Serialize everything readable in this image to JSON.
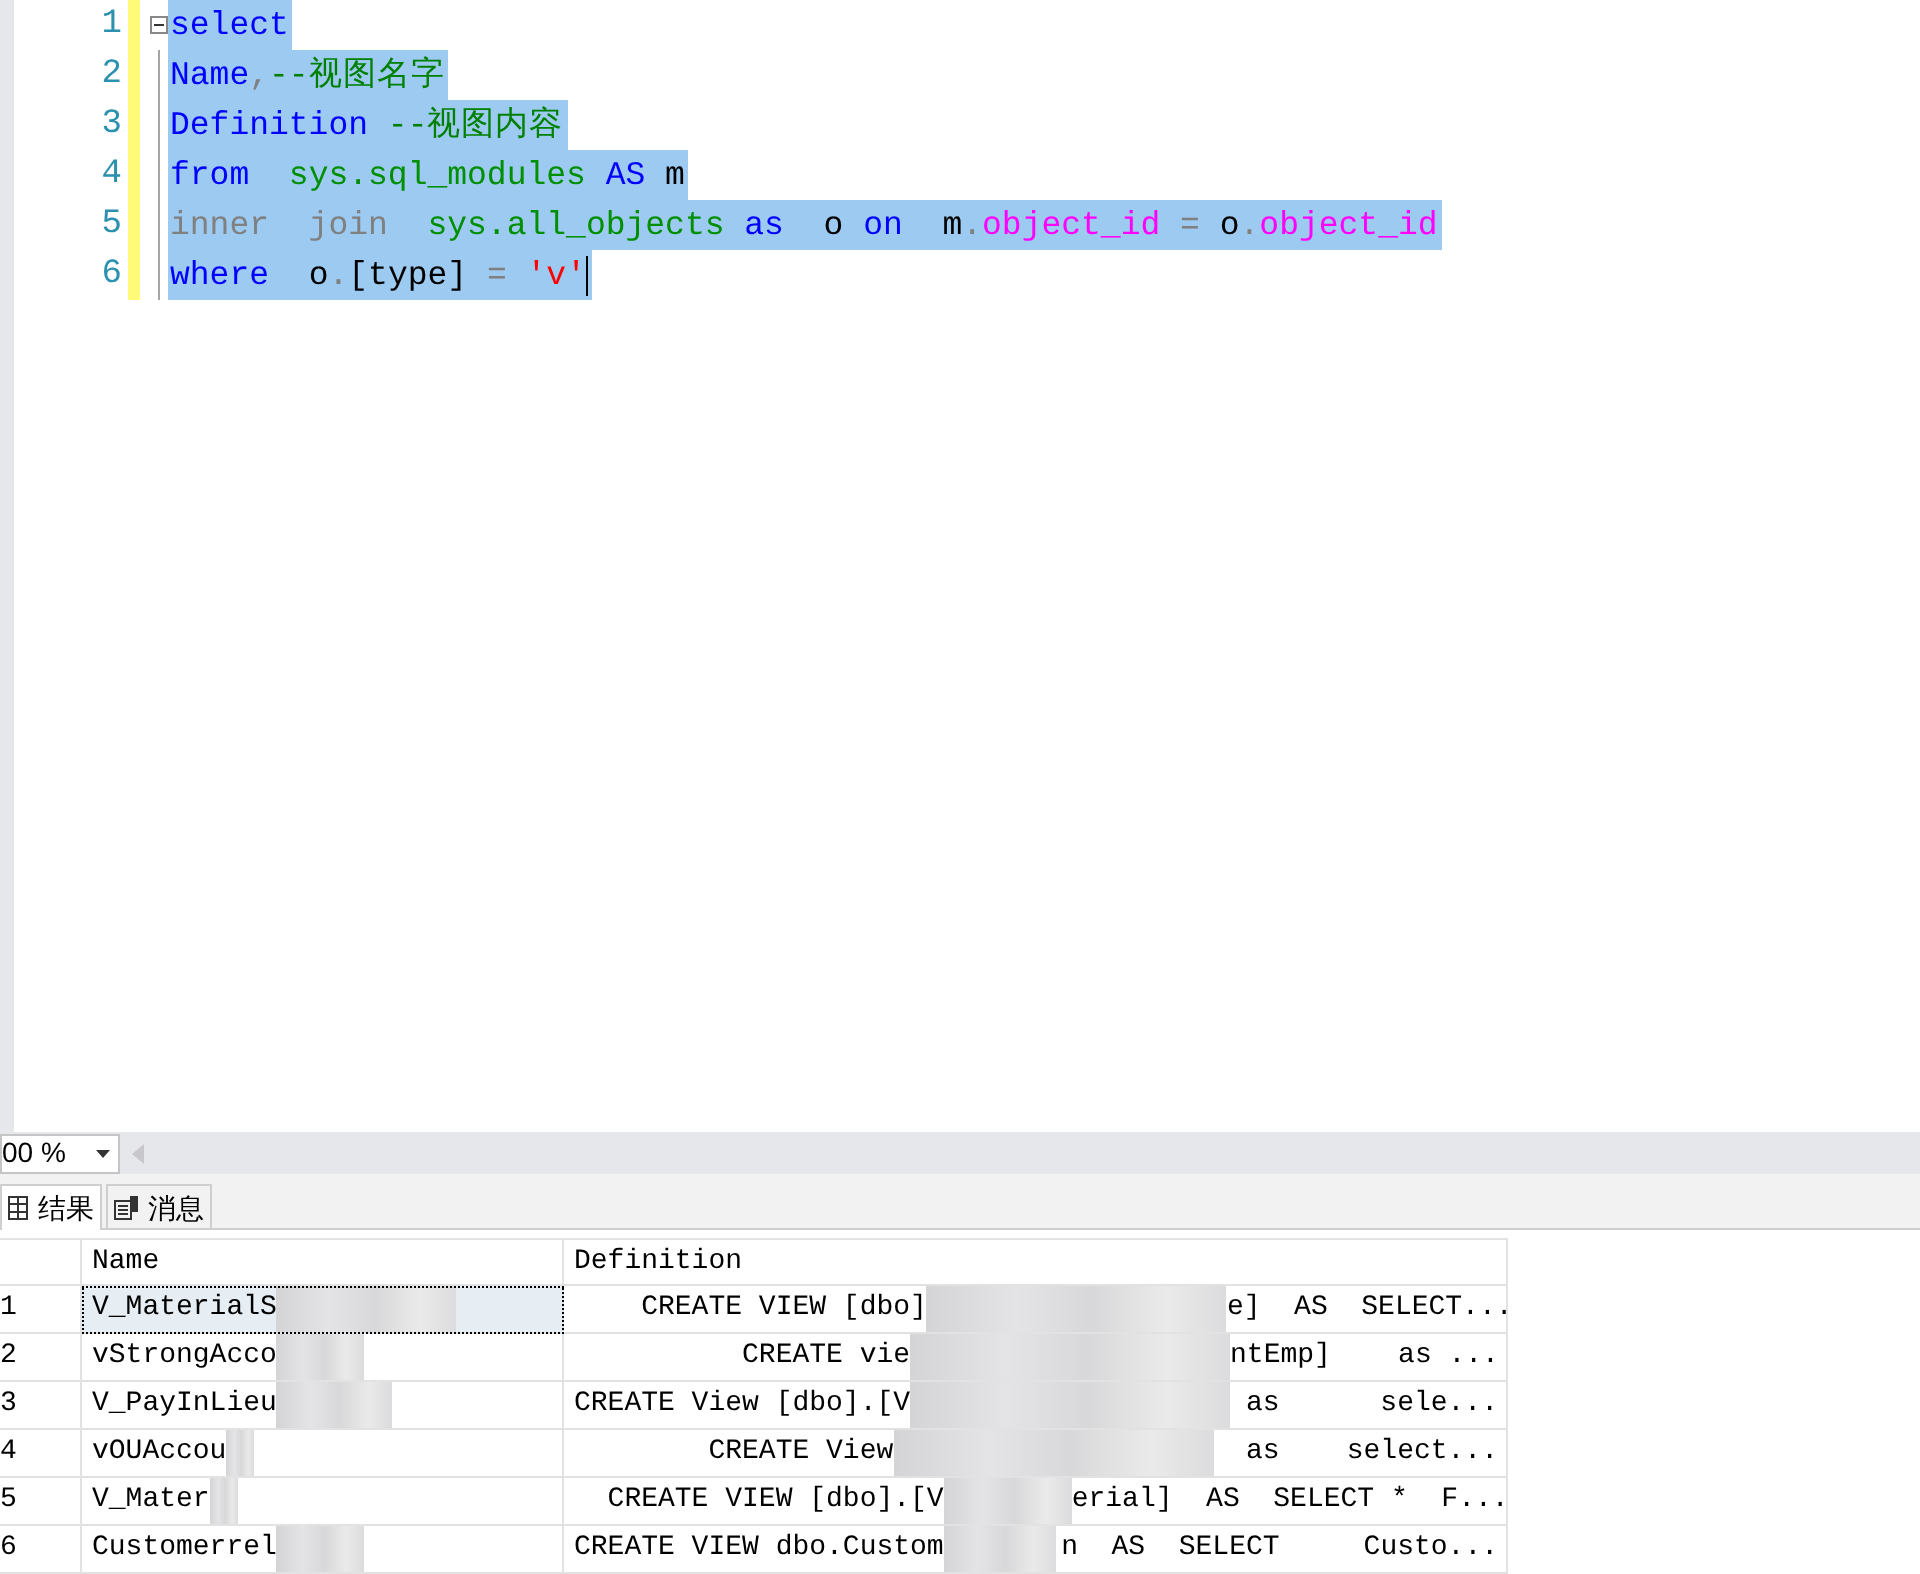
{
  "editor": {
    "lines": [
      {
        "number": "1",
        "selected": true,
        "fold": true,
        "tokens": [
          {
            "kind": "keyword",
            "text": "select"
          }
        ]
      },
      {
        "number": "2",
        "selected": true,
        "fold": false,
        "tokens": [
          {
            "kind": "keyword",
            "text": "Name"
          },
          {
            "kind": "operator",
            "text": ","
          },
          {
            "kind": "comment",
            "text": "--视图名字"
          }
        ]
      },
      {
        "number": "3",
        "selected": true,
        "fold": false,
        "tokens": [
          {
            "kind": "keyword",
            "text": "Definition"
          },
          {
            "kind": "comment",
            "text": " --视图内容"
          }
        ]
      },
      {
        "number": "4",
        "selected": true,
        "fold": false,
        "tokens": [
          {
            "kind": "keyword",
            "text": "from"
          },
          {
            "kind": "system",
            "text": "  sys.sql_modules"
          },
          {
            "kind": "keyword",
            "text": " AS"
          },
          {
            "kind": "plain",
            "text": " m"
          }
        ]
      },
      {
        "number": "5",
        "selected": true,
        "fold": false,
        "tokens": [
          {
            "kind": "operator",
            "text": "inner  join"
          },
          {
            "kind": "system",
            "text": "  sys.all_objects"
          },
          {
            "kind": "keyword",
            "text": " as"
          },
          {
            "kind": "plain",
            "text": "  o "
          },
          {
            "kind": "keyword",
            "text": "on"
          },
          {
            "kind": "plain",
            "text": "  m"
          },
          {
            "kind": "operator",
            "text": "."
          },
          {
            "kind": "function",
            "text": "object_id"
          },
          {
            "kind": "operator",
            "text": " ="
          },
          {
            "kind": "plain",
            "text": " o"
          },
          {
            "kind": "operator",
            "text": "."
          },
          {
            "kind": "function",
            "text": "object_id"
          }
        ]
      },
      {
        "number": "6",
        "selected": true,
        "fold": false,
        "tokens": [
          {
            "kind": "keyword",
            "text": "where"
          },
          {
            "kind": "plain",
            "text": "  o"
          },
          {
            "kind": "operator",
            "text": "."
          },
          {
            "kind": "plain",
            "text": "[type] "
          },
          {
            "kind": "operator",
            "text": "="
          },
          {
            "kind": "string",
            "text": " 'v'"
          }
        ]
      }
    ]
  },
  "zoom": {
    "value": "00 %"
  },
  "tabs": [
    {
      "label": "结果",
      "selected": true
    },
    {
      "label": "消息",
      "selected": false
    }
  ],
  "grid": {
    "columns": [
      "Name",
      "Definition"
    ],
    "rows": [
      {
        "number": "1",
        "selected": true,
        "name": "V_MaterialS",
        "definition_start": "    CREATE VIEW [dbo]",
        "definition_end": "e]  AS  SELECT..."
      },
      {
        "number": "2",
        "selected": false,
        "name": "vStrongAcco",
        "definition_start": "          CREATE vie",
        "definition_end": "ntEmp]    as ..."
      },
      {
        "number": "3",
        "selected": false,
        "name": "V_PayInLieu",
        "definition_start": "CREATE View [dbo].[V",
        "definition_end": "as      sele..."
      },
      {
        "number": "4",
        "selected": false,
        "name": "vOUAccou",
        "definition_start": "        CREATE View",
        "definition_end": "as    select..."
      },
      {
        "number": "5",
        "selected": false,
        "name": "V_Mater",
        "definition_start": "  CREATE VIEW [dbo].[V",
        "definition_end": "erial]  AS  SELECT *  F..."
      },
      {
        "number": "6",
        "selected": false,
        "name": "Customerrel",
        "definition_start": "CREATE VIEW dbo.Custom",
        "definition_end": "n  AS  SELECT     Custo..."
      }
    ]
  }
}
